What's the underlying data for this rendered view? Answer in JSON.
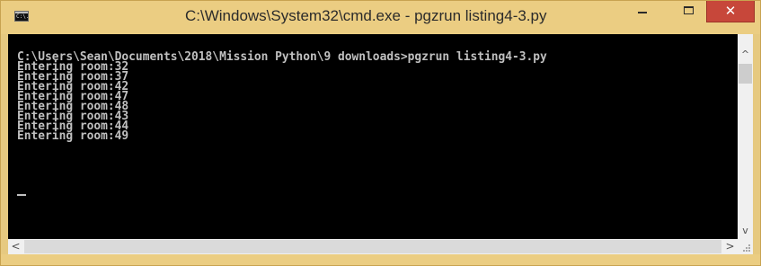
{
  "window": {
    "title": "C:\\Windows\\System32\\cmd.exe - pgzrun  listing4-3.py",
    "icon": "cmd-icon",
    "icon_text": "C:\\."
  },
  "controls": {
    "minimize": "minimize-icon",
    "maximize": "maximize-icon",
    "close": "close-icon",
    "close_glyph": "✕"
  },
  "console": {
    "lines": [
      "C:\\Users\\Sean\\Documents\\2018\\Mission Python\\9 downloads>pgzrun listing4-3.py",
      "Entering room:32",
      "Entering room:37",
      "Entering room:42",
      "Entering room:47",
      "Entering room:48",
      "Entering room:43",
      "Entering room:44",
      "Entering room:49"
    ],
    "text_color": "#c0c0c0",
    "background": "#000000"
  },
  "scrollbars": {
    "up_arrow": "^",
    "down_arrow": "v",
    "left_arrow": "<",
    "right_arrow": ">"
  },
  "colors": {
    "frame": "#ebcd82",
    "close_button": "#c7473a"
  }
}
